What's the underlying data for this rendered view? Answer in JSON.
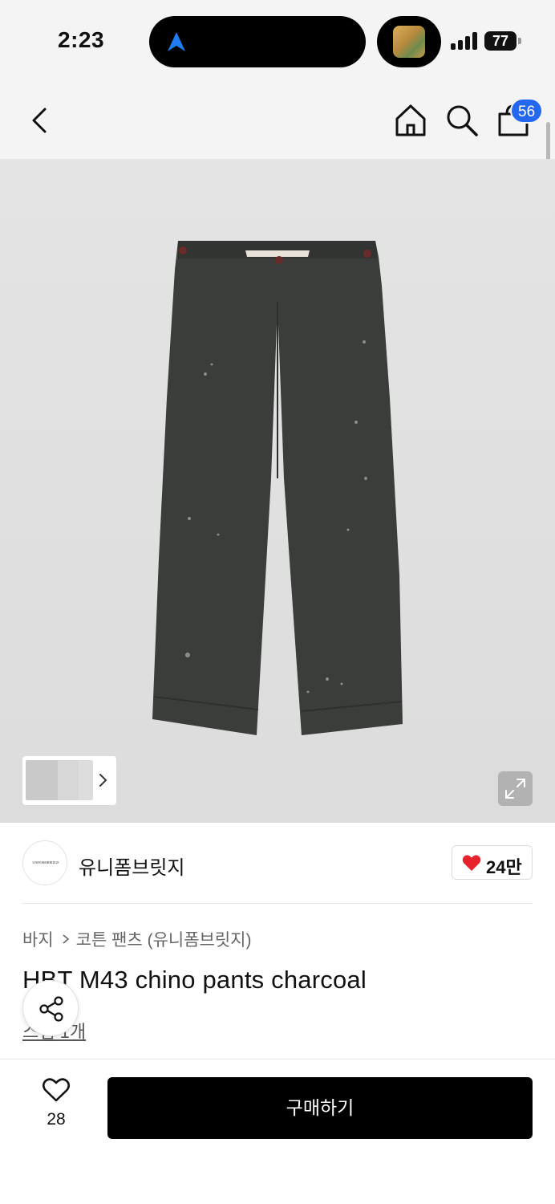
{
  "status_bar": {
    "time": "2:23",
    "battery": "77"
  },
  "header": {
    "cart_count": "56"
  },
  "product": {
    "brand_logo_text": "UNIFORMBRIDGE",
    "brand": "유니폼브릿지",
    "brand_likes": "24만",
    "breadcrumb": [
      "바지",
      "코튼 팬츠 (유니폼브릿지)"
    ],
    "title": "HBT M43 chino pants charcoal",
    "review_link": "스냅 1개",
    "image_alt": "charcoal wide chino pants"
  },
  "bottom_bar": {
    "wish_count": "28",
    "buy_label": "구매하기"
  },
  "colors": {
    "accent": "#2468f2",
    "heart": "#e8222c",
    "pants": "#3a3d3a",
    "button": "#000000"
  },
  "icons": [
    "navigation-arrow-icon",
    "back-chevron-icon",
    "home-icon",
    "search-icon",
    "shopping-bag-icon",
    "expand-icon",
    "share-icon",
    "heart-icon",
    "heart-outline-icon",
    "chevron-right-icon"
  ]
}
